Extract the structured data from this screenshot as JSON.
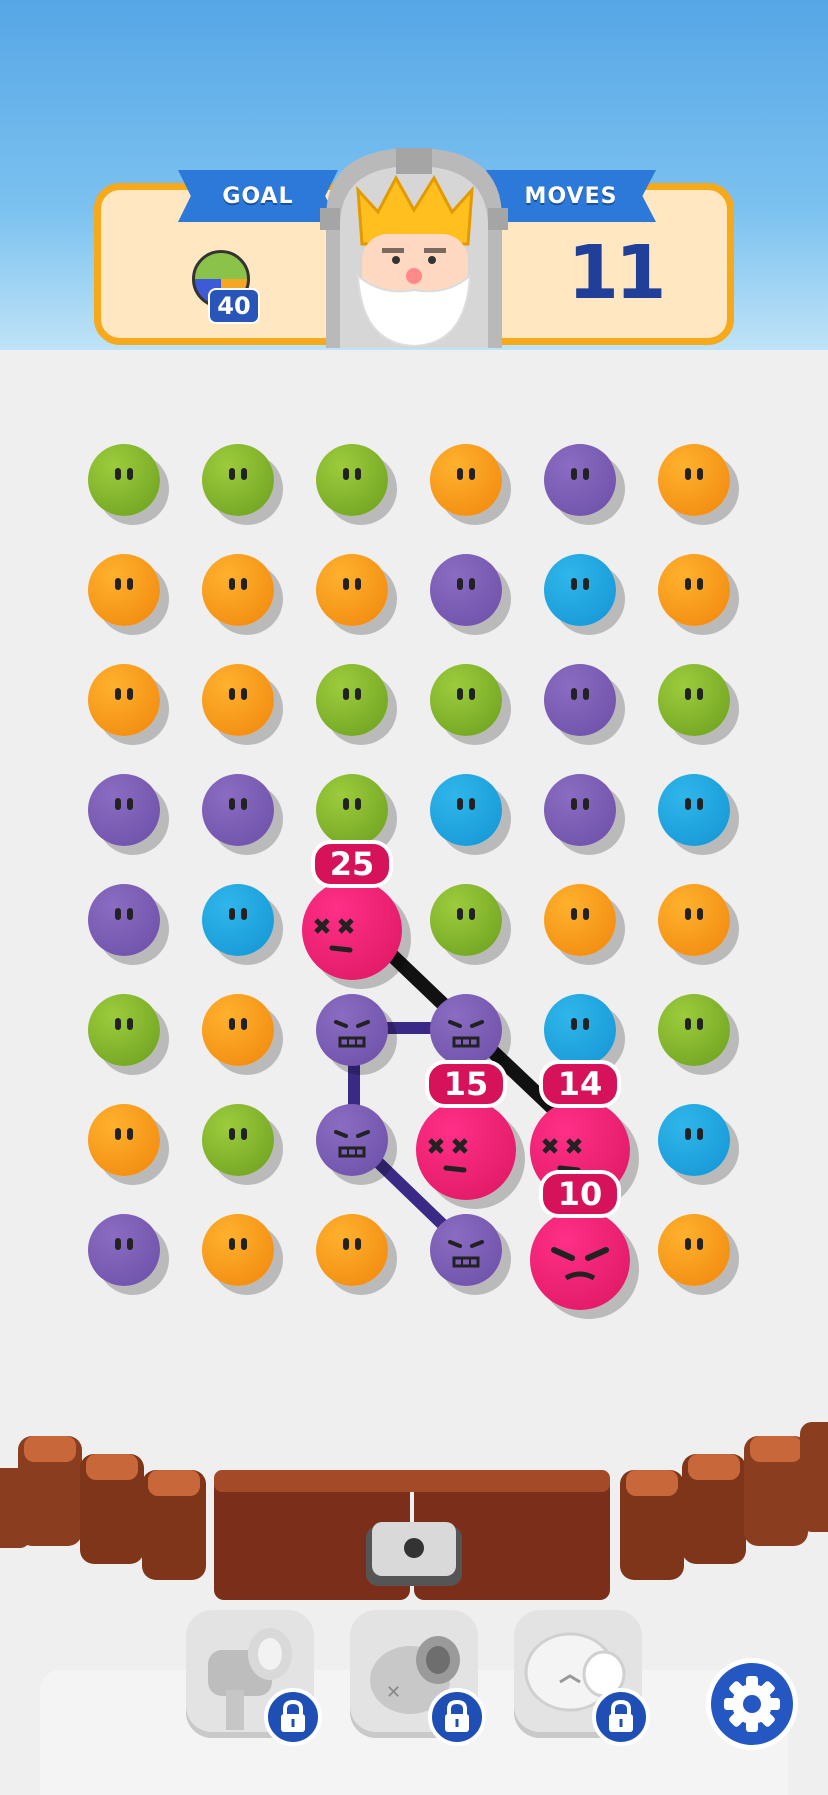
{
  "hud": {
    "goal_label": "GOAL",
    "goal_count": "40",
    "goal_icon": "striped-orb-icon",
    "moves_label": "MOVES",
    "moves_value": "11"
  },
  "board": {
    "rows": [
      [
        "green",
        "green",
        "green",
        "orange",
        "purple",
        "orange"
      ],
      [
        "orange",
        "orange",
        "orange",
        "purple",
        "blue",
        "orange"
      ],
      [
        "orange",
        "orange",
        "green",
        "green",
        "purple",
        "green"
      ],
      [
        "purple",
        "purple",
        "green",
        "blue",
        "purple",
        "blue"
      ],
      [
        "purple",
        "blue",
        "bomb",
        "green",
        "orange",
        "orange"
      ],
      [
        "green",
        "orange",
        "purple-linked",
        "purple-linked",
        "blue",
        "green"
      ],
      [
        "orange",
        "green",
        "purple-linked",
        "bomb",
        "bomb",
        "blue"
      ],
      [
        "purple",
        "orange",
        "orange",
        "purple-linked",
        "bomb",
        "orange"
      ]
    ],
    "bombs": [
      {
        "label": "25",
        "state": "defeated"
      },
      {
        "label": "15",
        "state": "defeated"
      },
      {
        "label": "14",
        "state": "defeated"
      },
      {
        "label": "10",
        "state": "angry"
      }
    ]
  },
  "boosters": [
    {
      "name": "hammer",
      "icon": "hammer-icon",
      "locked": true
    },
    {
      "name": "cannon",
      "icon": "cannon-icon",
      "locked": true
    },
    {
      "name": "glove",
      "icon": "glove-icon",
      "locked": true
    }
  ],
  "settings_icon": "gear-icon",
  "colors": {
    "green": "#8bbd2a",
    "orange": "#f79a1c",
    "purple": "#7a5cb4",
    "blue": "#1ea6e0",
    "bomb": "#ea1f72",
    "hud_blue": "#2d79d9",
    "panel_border": "#f7a91c"
  }
}
